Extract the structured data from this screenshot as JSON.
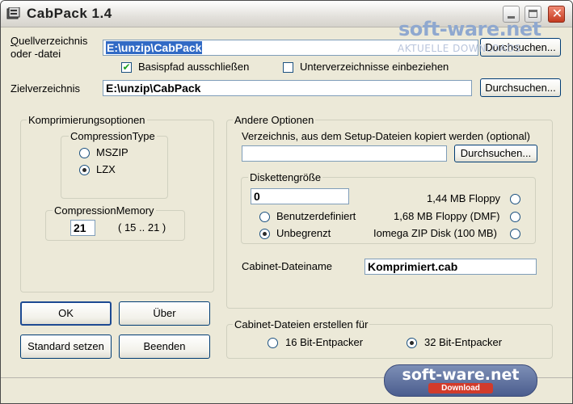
{
  "window": {
    "title": "CabPack 1.4"
  },
  "source": {
    "label_line1": "Quellverzeichnis",
    "label_line2": "oder -datei",
    "path": "E:\\unzip\\CabPack",
    "browse": "Durchsuchen..."
  },
  "options_row": {
    "basispfad": {
      "label": "Basispfad ausschließen",
      "checked": true
    },
    "unterverzeichnisse": {
      "label": "Unterverzeichnisse einbeziehen",
      "checked": false
    }
  },
  "target": {
    "label": "Zielverzeichnis",
    "path": "E:\\unzip\\CabPack",
    "browse": "Durchsuchen..."
  },
  "compression": {
    "group_title": "Komprimierungsoptionen",
    "type_group_title": "CompressionType",
    "types": [
      {
        "label": "MSZIP",
        "selected": false
      },
      {
        "label": "LZX",
        "selected": true
      }
    ],
    "memory_group_title": "CompressionMemory",
    "memory_value": "21",
    "memory_range": "( 15 .. 21 )"
  },
  "buttons": {
    "ok": "OK",
    "about": "Über",
    "defaults": "Standard setzen",
    "exit": "Beenden"
  },
  "other": {
    "group_title": "Andere Optionen",
    "setup_label": "Verzeichnis, aus dem Setup-Dateien kopiert werden (optional)",
    "setup_value": "",
    "browse": "Durchsuchen...",
    "disk_group_title": "Diskettengröße",
    "disk_value": "0",
    "disk_options": {
      "floppy144": {
        "label": "1,44 MB Floppy",
        "selected": false
      },
      "custom": {
        "label": "Benutzerdefiniert",
        "selected": false
      },
      "floppy168": {
        "label": "1,68 MB Floppy (DMF)",
        "selected": false
      },
      "unlimited": {
        "label": "Unbegrenzt",
        "selected": true
      },
      "zip": {
        "label": "Iomega ZIP Disk (100 MB)",
        "selected": false
      }
    },
    "cabinet_label": "Cabinet-Dateiname",
    "cabinet_value": "Komprimiert.cab"
  },
  "target_platform": {
    "group_title": "Cabinet-Dateien erstellen für",
    "options": [
      {
        "label": "16 Bit-Entpacker",
        "selected": false
      },
      {
        "label": "32 Bit-Entpacker",
        "selected": true
      }
    ]
  },
  "watermark": {
    "top_text": "soft-ware.net",
    "top_subtext": "AKTUELLE DOWNLOADS",
    "badge_text": "soft-ware.net",
    "badge_subtext": "Download"
  },
  "colors": {
    "selection": "#316ac5",
    "window_bg": "#ece9d8",
    "close_button": "#c43a1f"
  }
}
